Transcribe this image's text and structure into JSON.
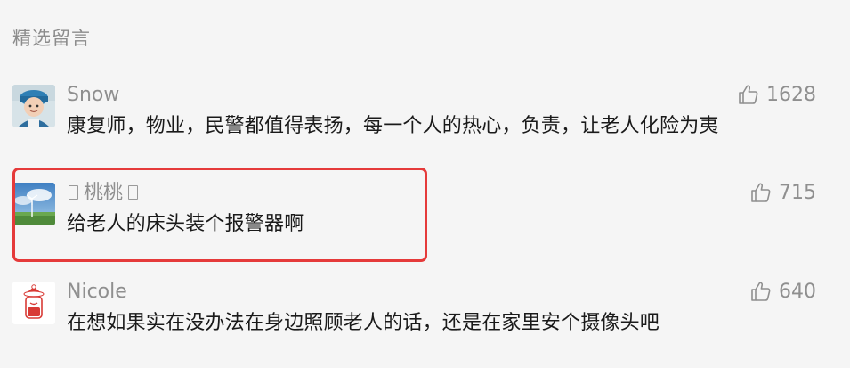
{
  "section": {
    "title": "精选留言"
  },
  "comments": [
    {
      "nickname": "Snow",
      "content": "康复师，物业，民警都值得表扬，每一个人的热心，负责，让老人化险为夷",
      "likes": "1628",
      "avatar": "boy-avatar"
    },
    {
      "nickname": "桃桃",
      "content": "给老人的床头装个报警器啊",
      "likes": "715",
      "avatar": "landscape-avatar"
    },
    {
      "nickname": "Nicole",
      "content": "在想如果实在没办法在身边照顾老人的话，还是在家里安个摄像头吧",
      "likes": "640",
      "avatar": "bottle-avatar"
    }
  ],
  "colors": {
    "background": "#f5f5f5",
    "muted_text": "#8f8f8f",
    "body_text": "#1a1a1a",
    "highlight": "#e53a3a"
  },
  "icons": {
    "like": "thumbs-up-icon",
    "unsupported_emoji": "missing-glyph-box"
  }
}
